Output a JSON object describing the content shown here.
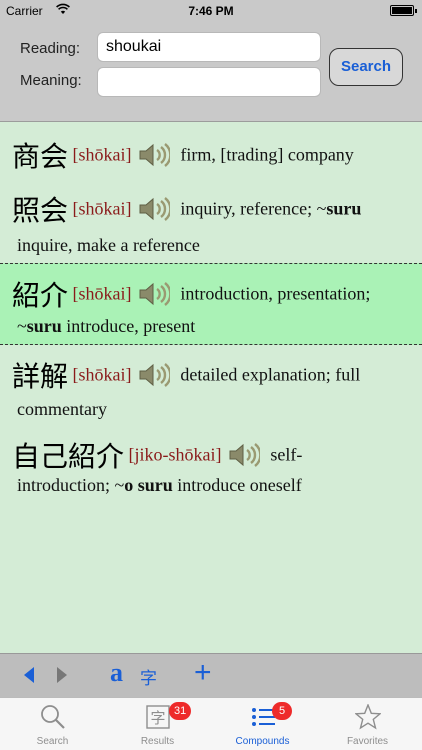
{
  "status_bar": {
    "carrier": "Carrier",
    "time": "7:46 PM"
  },
  "search": {
    "reading_label": "Reading:",
    "reading_value": "shoukai",
    "meaning_label": "Meaning:",
    "meaning_value": "",
    "search_button": "Search"
  },
  "results": [
    {
      "kanji": "商会",
      "reading": "[shōkai]",
      "def_line1": "firm, [trading] company",
      "def_line2": ""
    },
    {
      "kanji": "照会",
      "reading": "[shōkai]",
      "def_line1": "inquiry, reference; ~",
      "def_line1_bold": "suru",
      "def_line2": "inquire, make a reference"
    },
    {
      "kanji": "紹介",
      "reading": "[shōkai]",
      "def_line1": "introduction, presentation;",
      "def_line2_prefix": "~",
      "def_line2_bold": "suru",
      "def_line2": " introduce, present",
      "highlighted": true
    },
    {
      "kanji": "詳解",
      "reading": "[shōkai]",
      "def_line1": "detailed explanation; full",
      "def_line2": "commentary"
    },
    {
      "kanji": "自己紹介",
      "reading": "[jiko-shōkai]",
      "def_line1": "self-",
      "def_line2_prefix": "introduction; ~",
      "def_line2_bold": "o suru",
      "def_line2": " introduce oneself"
    }
  ],
  "toolbar": {
    "a_label": "a",
    "ji_label": "字",
    "plus_label": "+"
  },
  "tabs": [
    {
      "label": "Search",
      "icon": "magnifier-icon"
    },
    {
      "label": "Results",
      "icon": "kanji-box-icon",
      "badge": "31"
    },
    {
      "label": "Compounds",
      "icon": "list-icon",
      "badge": "5",
      "active": true
    },
    {
      "label": "Favorites",
      "icon": "star-icon"
    }
  ],
  "colors": {
    "accent": "#1a5fd6",
    "reading": "#8a1a1a",
    "highlight": "#aaf2b6",
    "background": "#d4ecd6",
    "badge": "#ee2a2a"
  }
}
